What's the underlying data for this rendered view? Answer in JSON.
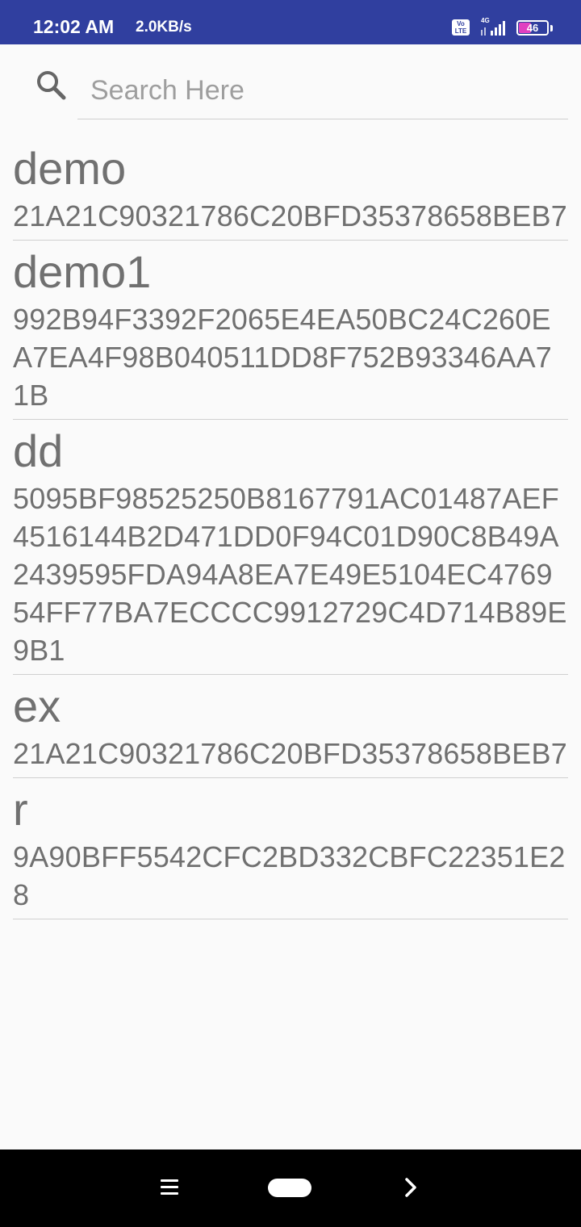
{
  "status_bar": {
    "time": "12:02 AM",
    "speed": "2.0KB/s",
    "volte_label": "Vo LTE",
    "network": "4G",
    "battery": "46"
  },
  "search": {
    "placeholder": "Search Here",
    "value": ""
  },
  "items": [
    {
      "name": "demo",
      "hash": "21A21C90321786C20BFD35378658BEB7"
    },
    {
      "name": "demo1",
      "hash": "992B94F3392F2065E4EA50BC24C260EA7EA4F98B040511DD8F752B93346AA71B"
    },
    {
      "name": "dd",
      "hash": "5095BF98525250B8167791AC01487AEF4516144B2D471DD0F94C01D90C8B49A2439595FDA94A8EA7E49E5104EC476954FF77BA7ECCCC9912729C4D714B89E9B1"
    },
    {
      "name": "ex",
      "hash": "21A21C90321786C20BFD35378658BEB7"
    },
    {
      "name": "r",
      "hash": "9A90BFF5542CFC2BD332CBFC22351E28"
    }
  ],
  "icons": {
    "search": "search-icon",
    "menu": "menu-icon",
    "home": "home-pill-icon",
    "back": "chevron-right-icon"
  },
  "colors": {
    "status_bar": "#303f9f",
    "battery": "#e040c0",
    "text": "#707070"
  }
}
